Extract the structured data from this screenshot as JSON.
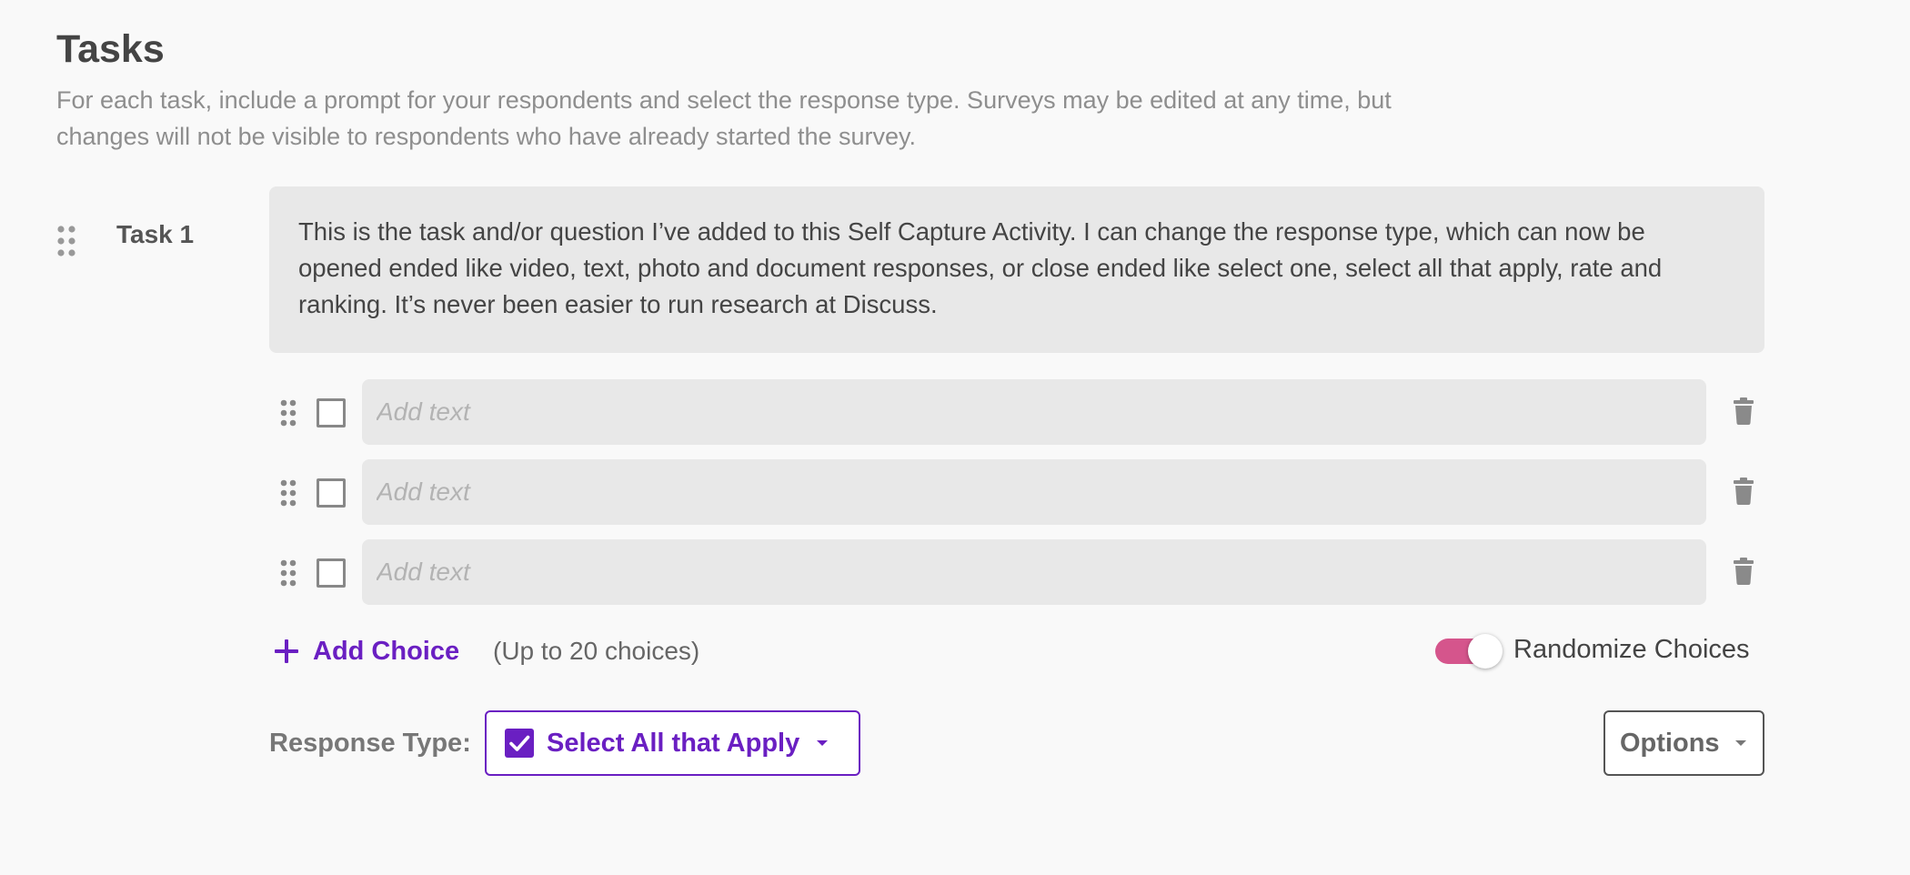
{
  "section": {
    "title": "Tasks",
    "description": "For each task, include a prompt for your respondents and select the response type. Surveys may be edited at any time, but changes will not be visible to respondents who have already started the survey."
  },
  "task": {
    "label": "Task 1",
    "prompt": "This is the task and/or question I’ve added to this Self Capture Activity. I can change the response type, which can now be opened ended like video, text, photo and document responses, or close ended like select one, select all that apply, rate and ranking. It’s never been easier to run research at Discuss."
  },
  "choices": [
    {
      "value": "",
      "placeholder": "Add text",
      "checked": false
    },
    {
      "value": "",
      "placeholder": "Add text",
      "checked": false
    },
    {
      "value": "",
      "placeholder": "Add text",
      "checked": false
    }
  ],
  "add_choice": {
    "label": "Add Choice",
    "limit_text": "(Up to 20 choices)"
  },
  "randomize": {
    "label": "Randomize Choices",
    "enabled": true
  },
  "response_type": {
    "label": "Response Type:",
    "selected": "Select All that Apply"
  },
  "options": {
    "label": "Options"
  },
  "colors": {
    "accent": "#6a1fc2",
    "toggle_on": "#d5558c",
    "field_bg": "#e8e8e8",
    "background": "#f9f9f9"
  },
  "icons": {
    "drag_handle": "drag-handle-icon",
    "trash": "trash-icon",
    "plus": "plus-icon",
    "checkbox_checked": "checkbox-checked-icon",
    "caret_down": "caret-down-icon"
  }
}
